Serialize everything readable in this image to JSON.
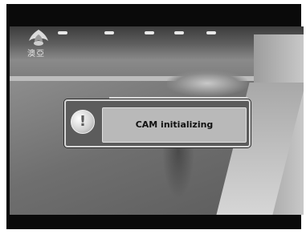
{
  "channel_logo": {
    "text": "澳亞",
    "icon": "bird-emblem-icon"
  },
  "dialog": {
    "icon": "exclamation-icon",
    "icon_glyph": "!",
    "message": "CAM initializing"
  }
}
